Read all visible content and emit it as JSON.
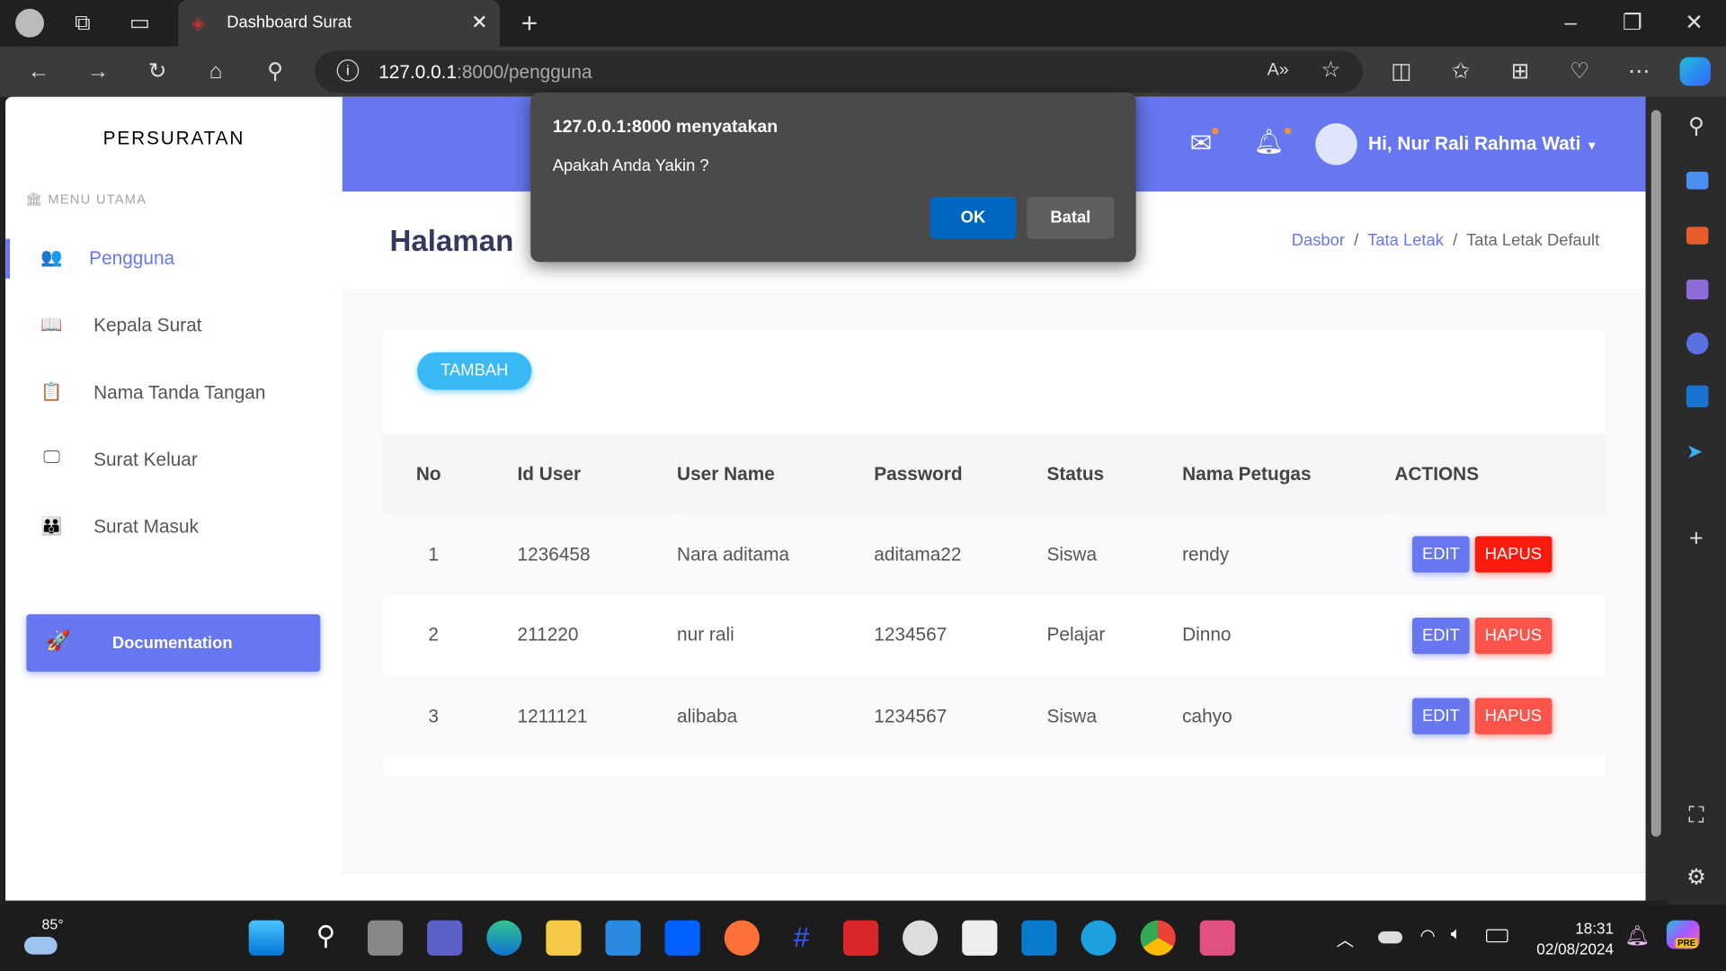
{
  "browser": {
    "tab_title": "Dashboard Surat",
    "url_host": "127.0.0.1",
    "url_rest": ":8000/pengguna"
  },
  "sidebar": {
    "brand": "PERSURATAN",
    "section": "MENU UTAMA",
    "items": [
      {
        "label": "Pengguna",
        "icon": "users-icon",
        "active": true
      },
      {
        "label": "Kepala Surat",
        "icon": "book-icon"
      },
      {
        "label": "Nama Tanda Tangan",
        "icon": "clipboard-check-icon"
      },
      {
        "label": "Surat Keluar",
        "icon": "chalkboard-icon"
      },
      {
        "label": "Surat Masuk",
        "icon": "users-group-icon"
      }
    ],
    "doc_button": "Documentation"
  },
  "header": {
    "user": "Hi, Nur Rali Rahma Wati",
    "accent": "#6777ef"
  },
  "page": {
    "title": "Halaman",
    "breadcrumb": [
      "Dasbor",
      "Tata Letak",
      "Tata Letak Default"
    ]
  },
  "main": {
    "add_button": "TAMBAH",
    "columns": [
      "No",
      "Id User",
      "User Name",
      "Password",
      "Status",
      "Nama Petugas",
      "ACTIONS"
    ],
    "rows": [
      [
        "1",
        "1236458",
        "Nara aditama",
        "aditama22",
        "Siswa",
        "rendy"
      ],
      [
        "2",
        "211220",
        "nur rali",
        "1234567",
        "Pelajar",
        "Dinno"
      ],
      [
        "3",
        "1211121",
        "alibaba",
        "1234567",
        "Siswa",
        "cahyo"
      ]
    ],
    "edit_label": "EDIT",
    "delete_label": "HAPUS"
  },
  "dialog": {
    "title": "127.0.0.1:8000 menyatakan",
    "message": "Apakah Anda Yakin ?",
    "ok": "OK",
    "cancel": "Batal"
  },
  "taskbar": {
    "weather": "85°",
    "time": "18:31",
    "date": "02/08/2024",
    "copilot_badge": "PRE"
  }
}
